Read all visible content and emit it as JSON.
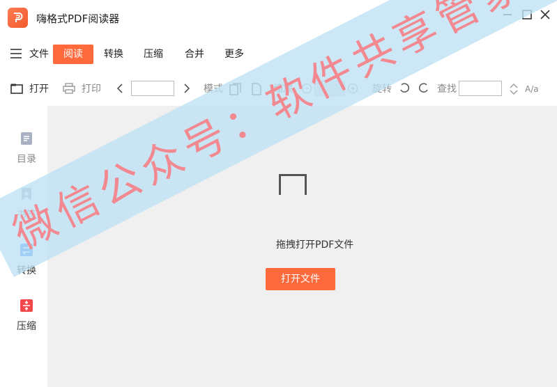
{
  "window": {
    "title": "嗨格式PDF阅读器"
  },
  "menu": {
    "file": "文件",
    "read": "阅读",
    "convert": "转换",
    "compress": "压缩",
    "merge": "合并",
    "more": "更多"
  },
  "toolbar": {
    "open": "打开",
    "print": "打印",
    "mode": "模式",
    "zoom": "缩放",
    "rotate": "旋转",
    "find": "查找",
    "case": "A/a"
  },
  "sidebar": {
    "items": [
      {
        "label": "目录"
      },
      {
        "label": "书签"
      },
      {
        "label": "转换"
      },
      {
        "label": "压缩"
      }
    ]
  },
  "main": {
    "drop_text": "拖拽打开PDF文件",
    "open_button": "打开文件"
  },
  "watermark": {
    "text": "微信公众号：软件共享管家"
  },
  "colors": {
    "accent": "#ff6a3d",
    "convert_icon": "#3b8af0",
    "compress_icon": "#f0484b"
  }
}
